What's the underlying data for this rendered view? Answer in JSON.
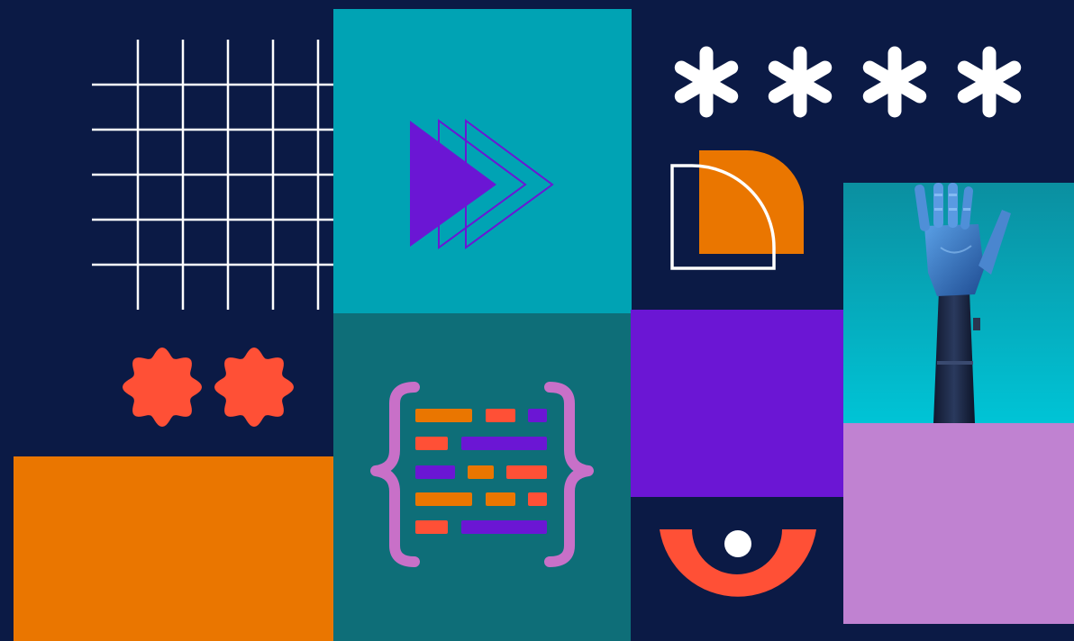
{
  "colors": {
    "navy": "#0b1a45",
    "teal": "#00a3b4",
    "dark_teal": "#0e6e78",
    "purple": "#6b16d4",
    "orange": "#ea7600",
    "coral": "#ff5036",
    "lilac": "#c082d1",
    "white": "#ffffff",
    "code_pink": "#c870c8"
  },
  "icons": [
    "grid-icon",
    "fast-forward-icon",
    "asterisk-icon",
    "quarter-circle-icon",
    "flower-icon",
    "code-braces-icon",
    "half-ring-eye-icon"
  ],
  "photo": {
    "subject": "robotic-hand"
  }
}
